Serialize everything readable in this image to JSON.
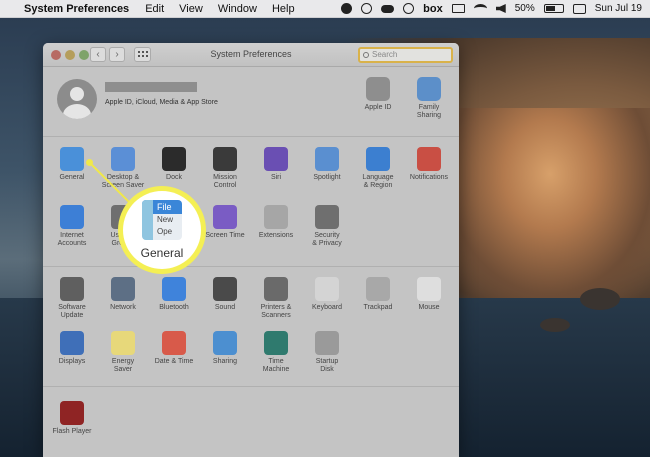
{
  "menubar": {
    "app_name": "System Preferences",
    "items": [
      "Edit",
      "View",
      "Window",
      "Help"
    ],
    "box_label": "box",
    "battery": "50%",
    "clock": "Sun Jul 19"
  },
  "window": {
    "title": "System Preferences",
    "search_placeholder": "Search"
  },
  "account": {
    "subtitle": "Apple ID, iCloud, Media & App Store",
    "apple_id_label": "Apple ID",
    "family_label": "Family\nSharing"
  },
  "row1": [
    {
      "label": "General",
      "icon": "general-icon",
      "color": "#4a90d9"
    },
    {
      "label": "Desktop &\nScreen Saver",
      "icon": "desktop-icon",
      "color": "#5b8fd6"
    },
    {
      "label": "Dock",
      "icon": "dock-icon",
      "color": "#2b2b2b"
    },
    {
      "label": "Mission\nControl",
      "icon": "mission-control-icon",
      "color": "#3a3a3a"
    },
    {
      "label": "Siri",
      "icon": "siri-icon",
      "color": "#6a4fb3"
    },
    {
      "label": "Spotlight",
      "icon": "spotlight-icon",
      "color": "#5a8fd0"
    },
    {
      "label": "Language\n& Region",
      "icon": "language-icon",
      "color": "#3c7fd0"
    },
    {
      "label": "Notifications",
      "icon": "notifications-icon",
      "color": "#c94f44"
    }
  ],
  "row2": [
    {
      "label": "Internet\nAccounts",
      "icon": "at-icon",
      "color": "#3d7fd6"
    },
    {
      "label": "Users &\nGroups",
      "icon": "users-icon",
      "color": "#6f6f6f"
    },
    {
      "label": "",
      "icon": "accessibility-icon",
      "color": "#4a7fd0"
    },
    {
      "label": "Screen Time",
      "icon": "hourglass-icon",
      "color": "#7a5cc4"
    },
    {
      "label": "Extensions",
      "icon": "puzzle-icon",
      "color": "#a6a6a6"
    },
    {
      "label": "Security\n& Privacy",
      "icon": "security-icon",
      "color": "#6f6f6f"
    }
  ],
  "row3": [
    {
      "label": "Software\nUpdate",
      "icon": "gear-icon",
      "color": "#5f5f5f"
    },
    {
      "label": "Network",
      "icon": "globe-icon",
      "color": "#5d6f85"
    },
    {
      "label": "Bluetooth",
      "icon": "bluetooth-icon",
      "color": "#3f83db"
    },
    {
      "label": "Sound",
      "icon": "speaker-icon",
      "color": "#4a4a4a"
    },
    {
      "label": "Printers &\nScanners",
      "icon": "printer-icon",
      "color": "#6a6a6a"
    },
    {
      "label": "Keyboard",
      "icon": "keyboard-icon",
      "color": "#d4d4d4"
    },
    {
      "label": "Trackpad",
      "icon": "trackpad-icon",
      "color": "#a8a8a8"
    },
    {
      "label": "Mouse",
      "icon": "mouse-icon",
      "color": "#dedede"
    }
  ],
  "row4": [
    {
      "label": "Displays",
      "icon": "display-icon",
      "color": "#3f6fb8"
    },
    {
      "label": "Energy\nSaver",
      "icon": "bulb-icon",
      "color": "#e7d87a"
    },
    {
      "label": "Date & Time",
      "icon": "calendar-icon",
      "color": "#d85a4a"
    },
    {
      "label": "Sharing",
      "icon": "sharing-icon",
      "color": "#4c8fd0"
    },
    {
      "label": "Time\nMachine",
      "icon": "time-machine-icon",
      "color": "#2f7a6e"
    },
    {
      "label": "Startup\nDisk",
      "icon": "disk-icon",
      "color": "#9a9a9a"
    }
  ],
  "row5": [
    {
      "label": "Flash Player",
      "icon": "flash-icon",
      "color": "#8f2424"
    }
  ],
  "magnifier": {
    "label": "General",
    "file": "File",
    "new": "New",
    "open": "Ope"
  }
}
